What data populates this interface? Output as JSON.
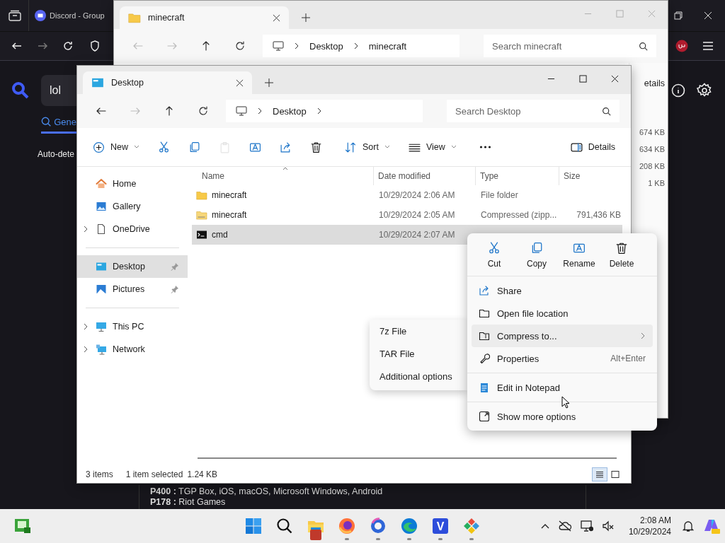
{
  "browser": {
    "tab": {
      "title": "Discord - Group"
    },
    "search_value": "lol",
    "section_tab": {
      "label": "Gene",
      "selected": true
    },
    "auto_detect": "Auto-dete",
    "details_lines": [
      "**P400 :** TGP Box, iOS, macOS, Microsoft Windows, Android",
      "**P178 :** Riot Games"
    ]
  },
  "back_window": {
    "tab": "minecraft",
    "address": [
      "Desktop",
      "minecraft"
    ],
    "search_placeholder": "Search minecraft",
    "details_button": "etails",
    "sizes": [
      "674 KB",
      "634 KB",
      "208 KB",
      "1 KB"
    ]
  },
  "explorer": {
    "tab": "Desktop",
    "address": [
      "Desktop"
    ],
    "search_placeholder": "Search Desktop",
    "nav": [
      {
        "kind": "back",
        "disabled": false
      },
      {
        "kind": "forward",
        "disabled": true
      },
      {
        "kind": "up",
        "disabled": false
      },
      {
        "kind": "refresh",
        "disabled": false
      }
    ],
    "toolbar": [
      {
        "kind": "new",
        "label": "New",
        "dropdown": true,
        "disabled": false
      },
      {
        "kind": "cut",
        "dropdown": false,
        "disabled": false
      },
      {
        "kind": "copy",
        "dropdown": false,
        "disabled": false
      },
      {
        "kind": "paste",
        "dropdown": false,
        "disabled": true
      },
      {
        "kind": "rename",
        "dropdown": false,
        "disabled": false
      },
      {
        "kind": "share",
        "dropdown": false,
        "disabled": false
      },
      {
        "kind": "delete",
        "dropdown": false,
        "disabled": false
      },
      {
        "kind": "sort",
        "label": "Sort",
        "dropdown": true,
        "disabled": false
      },
      {
        "kind": "view",
        "label": "View",
        "dropdown": true,
        "disabled": false
      },
      {
        "kind": "more",
        "dropdown": false,
        "disabled": false
      },
      {
        "kind": "details",
        "label": "Details",
        "dropdown": false,
        "disabled": false
      }
    ],
    "sidebar": [
      {
        "items": [
          {
            "kind": "home",
            "label": "Home",
            "expandable": false,
            "pinned": false,
            "selected": false
          },
          {
            "kind": "gallery",
            "label": "Gallery",
            "expandable": false,
            "pinned": false,
            "selected": false
          },
          {
            "kind": "onedrive",
            "label": "OneDrive",
            "expandable": true,
            "pinned": false,
            "selected": false
          }
        ]
      },
      {
        "items": [
          {
            "kind": "desktop",
            "label": "Desktop",
            "expandable": false,
            "pinned": true,
            "selected": true
          },
          {
            "kind": "pictures",
            "label": "Pictures",
            "expandable": false,
            "pinned": true,
            "selected": false
          }
        ]
      },
      {
        "items": [
          {
            "kind": "pc",
            "label": "This PC",
            "expandable": true,
            "pinned": false,
            "selected": false
          },
          {
            "kind": "network",
            "label": "Network",
            "expandable": true,
            "pinned": false,
            "selected": false
          }
        ]
      }
    ],
    "columns": [
      {
        "label": "Name",
        "sorted": true
      },
      {
        "label": "Date modified",
        "sorted": false
      },
      {
        "label": "Type",
        "sorted": false
      },
      {
        "label": "Size",
        "sorted": false
      }
    ],
    "files": [
      {
        "kind": "folder",
        "name": "minecraft",
        "date": "10/29/2024 2:06 AM",
        "type": "File folder",
        "selected": false
      },
      {
        "kind": "zip",
        "name": "minecraft",
        "date": "10/29/2024 2:05 AM",
        "type": "Compressed (zipp...",
        "size": "791,436 KB",
        "selected": false
      },
      {
        "kind": "cmd",
        "name": "cmd",
        "date": "10/29/2024 2:07 AM",
        "selected": true
      }
    ],
    "status": {
      "count": "3 items",
      "selection": "1 item selected",
      "size": "1.24 KB"
    },
    "view_modes": [
      {
        "kind": "details",
        "selected": true
      },
      {
        "kind": "tiles",
        "selected": false
      }
    ]
  },
  "context_menu": {
    "actions": [
      {
        "kind": "cut",
        "label": "Cut"
      },
      {
        "kind": "copy",
        "label": "Copy"
      },
      {
        "kind": "rename",
        "label": "Rename"
      },
      {
        "kind": "delete",
        "label": "Delete"
      }
    ],
    "items": [
      {
        "kind": "share",
        "label": "Share",
        "selected": false
      },
      {
        "kind": "location",
        "label": "Open file location",
        "selected": false
      },
      {
        "kind": "compress",
        "label": "Compress to...",
        "submenu": true,
        "selected": true
      },
      {
        "kind": "properties",
        "label": "Properties",
        "shortcut": "Alt+Enter",
        "selected": false
      },
      {
        "kind": "separator"
      },
      {
        "kind": "notepad",
        "label": "Edit in Notepad",
        "selected": false
      },
      {
        "kind": "separator"
      },
      {
        "kind": "moreoptions",
        "label": "Show more options",
        "selected": false
      }
    ],
    "submenu": [
      "7z File",
      "TAR File",
      "Additional options"
    ]
  },
  "taskbar": {
    "apps": [
      {
        "kind": "start"
      },
      {
        "kind": "search"
      },
      {
        "kind": "explorer",
        "running": true,
        "active": true
      },
      {
        "kind": "firefox",
        "running": true,
        "active": false
      },
      {
        "kind": "copilot",
        "running": true,
        "active": false
      },
      {
        "kind": "edge",
        "running": true,
        "active": false
      },
      {
        "kind": "v",
        "running": true,
        "active": false
      },
      {
        "kind": "diamonds",
        "running": true,
        "active": false
      }
    ],
    "app_letter": "V",
    "time": "2:08 AM",
    "date": "10/29/2024"
  }
}
